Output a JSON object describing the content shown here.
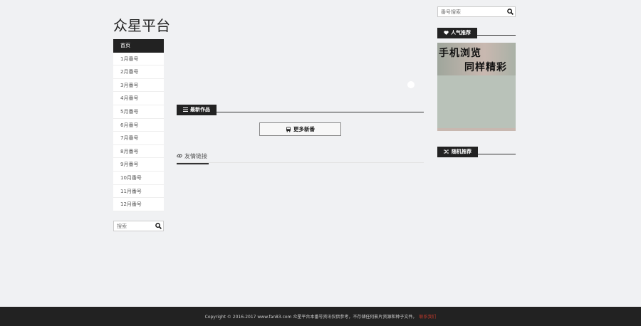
{
  "site": {
    "title": "众星平台"
  },
  "nav": {
    "items": [
      {
        "label": "首页",
        "active": true
      },
      {
        "label": "1月番号"
      },
      {
        "label": "2月番号"
      },
      {
        "label": "3月番号"
      },
      {
        "label": "4月番号"
      },
      {
        "label": "5月番号"
      },
      {
        "label": "6月番号"
      },
      {
        "label": "7月番号"
      },
      {
        "label": "8月番号"
      },
      {
        "label": "9月番号"
      },
      {
        "label": "10月番号"
      },
      {
        "label": "11月番号"
      },
      {
        "label": "12月番号"
      }
    ]
  },
  "left_search": {
    "placeholder": "搜索"
  },
  "right_search": {
    "placeholder": "番号搜索"
  },
  "main": {
    "latest_label": "最新作品",
    "more_button": "更多新番",
    "friend_links_label": "友情链接"
  },
  "sidebar": {
    "popular_label": "人气推荐",
    "random_label": "随机推荐",
    "promo_line1": "手机浏览",
    "promo_line2": "同样精彩"
  },
  "footer": {
    "text": "Copyright © 2016-2017 www.fan83.com 众星平台本番号资讯仅供参考，不存储任何影片资源和种子文件。",
    "contact": "联系我们"
  },
  "colors": {
    "dark": "#222222",
    "background": "#f0f1f3",
    "footer_link": "#c0392b"
  }
}
